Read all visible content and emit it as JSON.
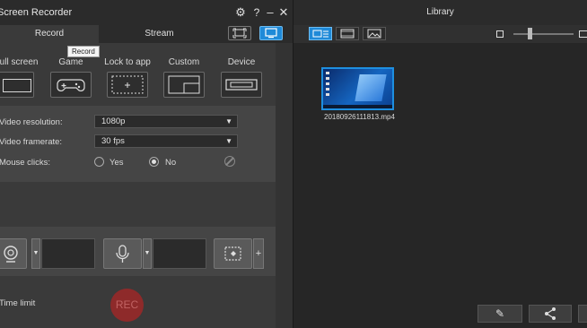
{
  "recorder": {
    "title": "Screen Recorder",
    "icons": {
      "settings": "gear-icon",
      "help": "help-icon",
      "minimize": "minimize-icon",
      "close": "close-icon"
    },
    "tabs": [
      {
        "label": "Record"
      },
      {
        "label": "Stream"
      }
    ],
    "tooltip": "Record",
    "modes": [
      {
        "label": "Full screen"
      },
      {
        "label": "Game"
      },
      {
        "label": "Lock to app"
      },
      {
        "label": "Custom"
      },
      {
        "label": "Device"
      }
    ],
    "settings": {
      "resolution_label": "Video resolution:",
      "resolution_value": "1080p",
      "framerate_label": "Video framerate:",
      "framerate_value": "30 fps",
      "clicks_label": "Mouse clicks:",
      "clicks_yes": "Yes",
      "clicks_no": "No",
      "clicks_selected": "No"
    },
    "time_limit_label": "Time limit",
    "rec_label": "REC",
    "accent_color": "#1f8ad8"
  },
  "library": {
    "title": "Library",
    "files": [
      {
        "name": "20180926111813.mp4"
      }
    ],
    "icons": {
      "edit": "pencil-icon",
      "share": "share-icon"
    }
  }
}
